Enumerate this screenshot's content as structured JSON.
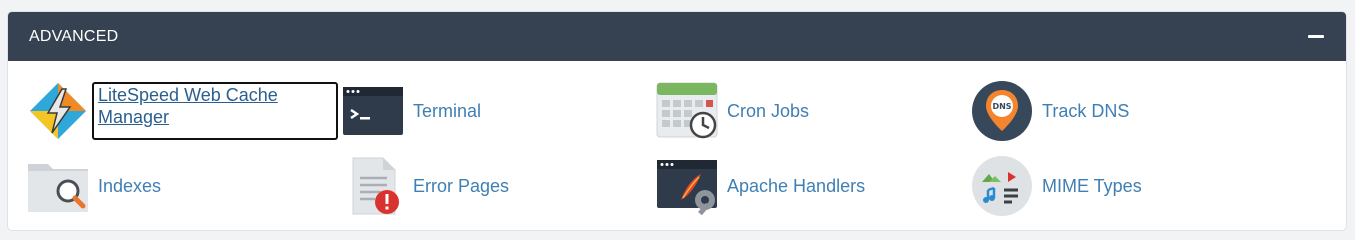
{
  "section": {
    "title": "ADVANCED",
    "collapse_icon": "minus-icon"
  },
  "items": [
    {
      "label": "LiteSpeed Web Cache Manager",
      "icon": "litespeed-icon"
    },
    {
      "label": "Terminal",
      "icon": "terminal-icon"
    },
    {
      "label": "Cron Jobs",
      "icon": "calendar-clock-icon"
    },
    {
      "label": "Track DNS",
      "icon": "dns-pin-icon"
    },
    {
      "label": "Indexes",
      "icon": "folder-search-icon"
    },
    {
      "label": "Error Pages",
      "icon": "document-error-icon"
    },
    {
      "label": "Apache Handlers",
      "icon": "window-feather-wrench-icon"
    },
    {
      "label": "MIME Types",
      "icon": "media-types-icon"
    }
  ],
  "colors": {
    "header_bg": "#364252",
    "link": "#3f7fb4",
    "page_bg": "#f1f3f5"
  }
}
